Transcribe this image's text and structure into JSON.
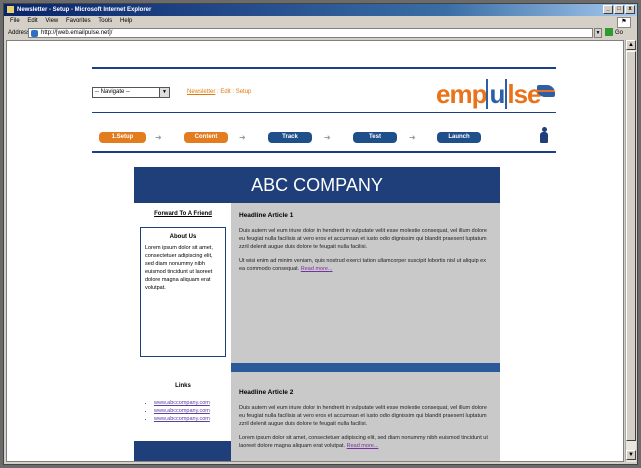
{
  "window": {
    "title": "Newsletter - Setup - Microsoft Internet Explorer",
    "controls": [
      "_",
      "□",
      "x"
    ]
  },
  "menu": [
    "File",
    "Edit",
    "View",
    "Favorites",
    "Tools",
    "Help"
  ],
  "address": {
    "label": "Address",
    "url": "http://[web.emailpulse.net]/",
    "go_label": "Go"
  },
  "header": {
    "navigate_select": "-- Navigate --",
    "links": [
      "Newsletter",
      "Edit",
      "Setup"
    ],
    "logo_part1": "emp",
    "logo_part2": "u",
    "logo_part3": "lse"
  },
  "steps": [
    {
      "label": "1.Setup",
      "color": "orange"
    },
    {
      "label": "Content",
      "color": "orange"
    },
    {
      "label": "Track",
      "color": "blue"
    },
    {
      "label": "Test",
      "color": "blue"
    },
    {
      "label": "Launch",
      "color": "blue"
    }
  ],
  "email": {
    "company": "ABC COMPANY",
    "forward_link": "Forward To A Friend",
    "about_title": "About Us",
    "about_text": "Lorem ipsum dolor sit amet, consectetuer adipiscing elit, sed diam nonummy nibh euismod tincidunt ut laoreet dolore magna aliquam erat volutpat.",
    "links_title": "Links",
    "links": [
      "www.abccompany.com",
      "www.abccompany.com",
      "www.abccompany.com"
    ],
    "articles": [
      {
        "headline": "Headline Article 1",
        "p1": "Duis autem vel eum iriure dolor in hendrerit in vulputate velit esse molestie consequat, vel illum dolore eu feugiat nulla facilisis at vero eros et accumsan et iusto odio dignissim qui blandit praesent luptatum zzril delenit augue duis dolore te feugait nulla facilisi.",
        "p2": "Ut wisi enim ad minim veniam, quis nostrud exerci tation ullamcorper suscipit lobortis nisl ut aliquip ex ea commodo consequat.",
        "read_more": "Read more..."
      },
      {
        "headline": "Headline Article 2",
        "p1": "Duis autem vel eum iriure dolor in hendrerit in vulputate velit esse molestie consequat, vel illum dolore eu feugiat nulla facilisis at vero eros et accumsan et iusto odio dignissim qui blandit praesent luptatum zzril delenit augue duis dolore te feugait nulla facilisi.",
        "p2": "Lorem ipsum dolor sit amet, consectetuer adipiscing elit, sed diam nonummy nibh euismod tincidunt ut laoreet dolore magna aliquam erat volutpat.",
        "read_more": "Read more..."
      }
    ]
  },
  "colors": {
    "navy": "#1e3f7a",
    "orange": "#e37b1f",
    "gray": "#c9c9c9"
  }
}
